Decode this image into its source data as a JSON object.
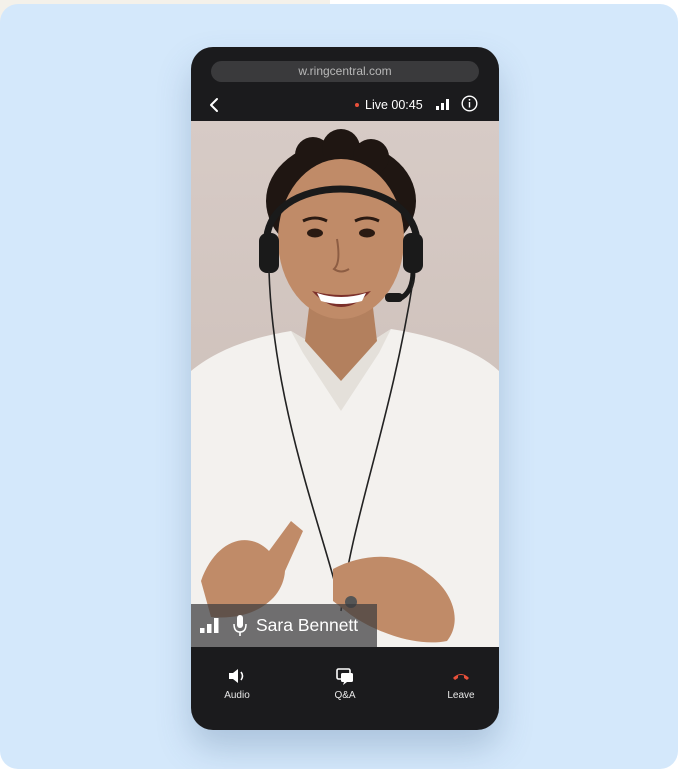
{
  "browser": {
    "url": "w.ringcentral.com"
  },
  "topbar": {
    "live_label": "Live 00:45"
  },
  "video": {
    "speaker_name": "Sara Bennett"
  },
  "controls": {
    "audio_label": "Audio",
    "qa_label": "Q&A",
    "leave_label": "Leave"
  },
  "colors": {
    "background": "#d4e8fb",
    "phone": "#1b1b1d",
    "live_dot": "#e8503a",
    "leave_icon": "#e8503a"
  },
  "icons": [
    "back-icon",
    "signal-icon",
    "info-icon",
    "microphone-icon",
    "speaker-icon",
    "qa-icon",
    "phone-hangup-icon"
  ]
}
